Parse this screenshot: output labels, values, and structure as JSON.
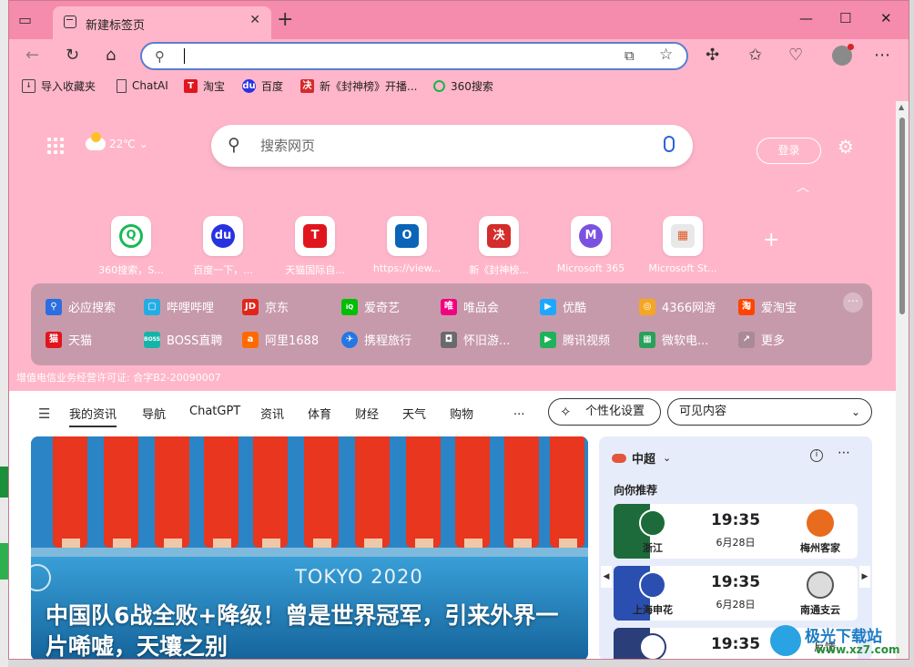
{
  "browser": {
    "tab_title": "新建标签页",
    "tab_close": "✕",
    "new_tab": "+",
    "window_controls": [
      "—",
      "☐",
      "✕"
    ]
  },
  "address_bar": {
    "value": "",
    "placeholder": ""
  },
  "favorites": [
    {
      "label": "导入收藏夹",
      "icon": "import-icon",
      "color": "#444444"
    },
    {
      "label": "ChatAI",
      "icon": "page-icon",
      "color": "#444444"
    },
    {
      "label": "淘宝",
      "icon": "taobao-icon",
      "color": "#e0151d"
    },
    {
      "label": "百度",
      "icon": "baidu-icon",
      "color": "#2932e1"
    },
    {
      "label": "新《封神榜》开播...",
      "icon": "fengshen-icon",
      "color": "#d42b2b"
    },
    {
      "label": "360搜索",
      "icon": "360-icon",
      "color": "#20b24a"
    }
  ],
  "newtab": {
    "weather": "22℃",
    "search_placeholder": "搜索网页",
    "login": "登录",
    "quicklinks": [
      {
        "label": "360搜索，S...",
        "logo": "Q",
        "color": "#19b955"
      },
      {
        "label": "百度一下，...",
        "logo": "du",
        "color": "#2932e1"
      },
      {
        "label": "天猫国际自...",
        "logo": "T",
        "color": "#e0151d"
      },
      {
        "label": "https://view...",
        "logo": "O",
        "color": "#0a64b8"
      },
      {
        "label": "新《封神榜...",
        "logo": "决",
        "color": "#d42b2b"
      },
      {
        "label": "Microsoft 365",
        "logo": "M",
        "color": "#7b52e0"
      },
      {
        "label": "Microsoft St...",
        "logo": "▦",
        "color": "#e8e8e8"
      }
    ],
    "sites_row1": [
      {
        "label": "必应搜索",
        "color": "#2b6ee0"
      },
      {
        "label": "哔哩哔哩",
        "color": "#23ade5"
      },
      {
        "label": "京东",
        "color": "#e1251b"
      },
      {
        "label": "爱奇艺",
        "color": "#00be06"
      },
      {
        "label": "唯品会",
        "color": "#f10180"
      },
      {
        "label": "优酷",
        "color": "#1ea7ff"
      },
      {
        "label": "4366网游",
        "color": "#f5a623"
      },
      {
        "label": "爱淘宝",
        "color": "#ff4400"
      }
    ],
    "sites_row2": [
      {
        "label": "天猫",
        "color": "#e0151d"
      },
      {
        "label": "BOSS直聘",
        "color": "#14b5a8"
      },
      {
        "label": "阿里1688",
        "color": "#ff6a00"
      },
      {
        "label": "携程旅行",
        "color": "#2577e3"
      },
      {
        "label": "怀旧游...",
        "color": "#6a6a6a"
      },
      {
        "label": "腾讯视频",
        "color": "#20b25b"
      },
      {
        "label": "微软电...",
        "color": "#2aa05a"
      },
      {
        "label": "更多",
        "color": "#888888"
      }
    ],
    "license": "增值电信业务经营许可证: 合字B2-20090007"
  },
  "feed_nav": {
    "items": [
      "我的资讯",
      "导航",
      "ChatGPT",
      "资讯",
      "体育",
      "财经",
      "天气",
      "购物"
    ],
    "more": "...",
    "personalize": "个性化设置",
    "visible_content": "可见内容"
  },
  "hero": {
    "image_text": "TOKYO 2020",
    "headline": "中国队6战全败+降级！曾是世界冠军，引来外界一片唏嘘，天壤之别"
  },
  "sports": {
    "league": "中超",
    "recommend": "向你推荐",
    "matches": [
      {
        "home": "浙江",
        "away": "梅州客家",
        "time": "19:35",
        "date": "6月28日",
        "stripe": "#1d6b3a",
        "home_color": "#1d6b3a",
        "away_color": "#e86b1e"
      },
      {
        "home": "上海申花",
        "away": "南通支云",
        "time": "19:35",
        "date": "6月28日",
        "stripe": "#2a4fb0",
        "home_color": "#2a4fb0",
        "away_color": "#555555"
      },
      {
        "home": "",
        "away": "",
        "time": "19:35",
        "date": "",
        "stripe": "#2a3f7a",
        "home_color": "#2a3f7a",
        "away_color": "#1e7d3a"
      }
    ]
  },
  "feedback": "反馈",
  "watermark": {
    "text": "极光下载站",
    "url": "www.xz7.com"
  }
}
